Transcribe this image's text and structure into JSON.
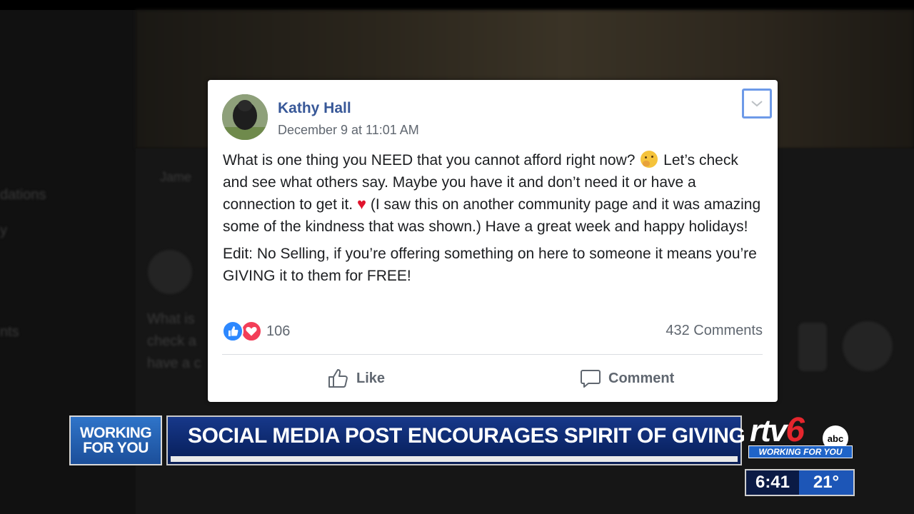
{
  "background": {
    "ghost_text": [
      "Jame",
      "dations",
      "y",
      "nts",
      "What is",
      "check a",
      "have a c"
    ]
  },
  "post": {
    "author": "Kathy Hall",
    "timestamp": "December 9 at 11:01 AM",
    "text_line1_a": "What is one thing you NEED that you cannot afford right now?",
    "text_line1_b": "Let’s check and see what others say. Maybe you have it and don’t need it or have a connection to get it.",
    "text_line1_c": "(I saw this on another community page and it was amazing some of the kindness that was shown.) Have a great week and happy holidays!",
    "heart_emoji": "♥",
    "text_edit": "Edit: No Selling, if you’re offering something on here to someone it means you’re GIVING it to them for FREE!",
    "reaction_count": "106",
    "comments_count": "432 Comments",
    "like_label": "Like",
    "comment_label": "Comment",
    "icons": [
      "chevron-down-icon",
      "thumbs-up-icon",
      "heart-icon",
      "comment-bubble-icon",
      "thinking-face-emoji"
    ],
    "colors": {
      "author": "#385898",
      "like_reaction": "#2d88ff",
      "love_reaction": "#f33e58"
    }
  },
  "broadcast": {
    "segment_line1": "WORKING",
    "segment_line2": "FOR YOU",
    "headline": "SOCIAL MEDIA POST ENCOURAGES SPIRIT OF GIVING",
    "logo_prefix": "rtv",
    "logo_number": "6",
    "logo_network": "abc",
    "logo_tagline": "WORKING FOR YOU",
    "time": "6:41",
    "temperature": "21°",
    "colors": {
      "headline_bar": "#0b2566",
      "segment_box": "#2f74c9",
      "logo_six": "#e5262d"
    }
  }
}
